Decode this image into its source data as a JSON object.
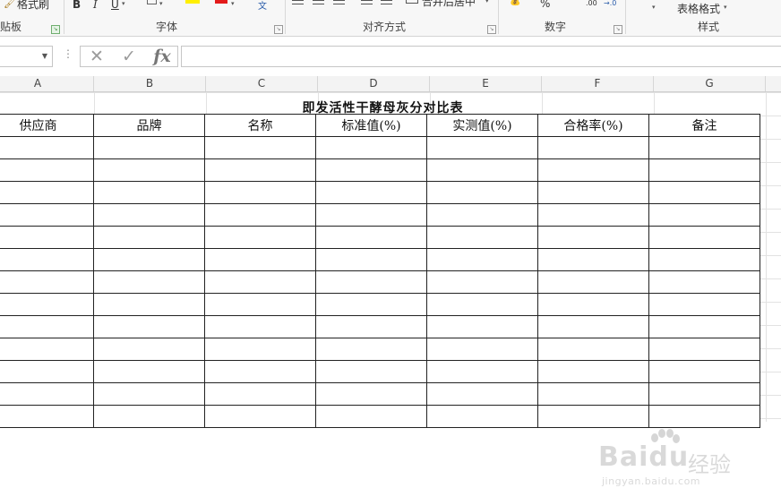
{
  "ribbon": {
    "clipboard": {
      "format_painter": "格式刷",
      "label": "贴板"
    },
    "font": {
      "bold": "B",
      "italic": "I",
      "underline": "U",
      "label": "字体"
    },
    "alignment": {
      "merge_center": "合并后居中",
      "label": "对齐方式"
    },
    "number": {
      "percent": "%",
      "decimal_increase": ".00",
      "decimal_decrease": "→.0",
      "label": "数字"
    },
    "styles": {
      "table_format": "表格格式",
      "label": "样式"
    }
  },
  "formula_bar": {
    "name_box": "",
    "cancel_icon": "✕",
    "confirm_icon": "✓",
    "fx": "fx",
    "value": ""
  },
  "columns": [
    "A",
    "B",
    "C",
    "D",
    "E",
    "F",
    "G"
  ],
  "sheet": {
    "title": "即发活性干酵母灰分对比表",
    "headers": [
      "供应商",
      "品牌",
      "名称",
      "标准值(%)",
      "实测值(%)",
      "合格率(%)",
      "备注"
    ],
    "row_count": 13
  },
  "watermark": {
    "brand": "Baidu",
    "sub": "经验",
    "url": "jingyan.baidu.com"
  }
}
